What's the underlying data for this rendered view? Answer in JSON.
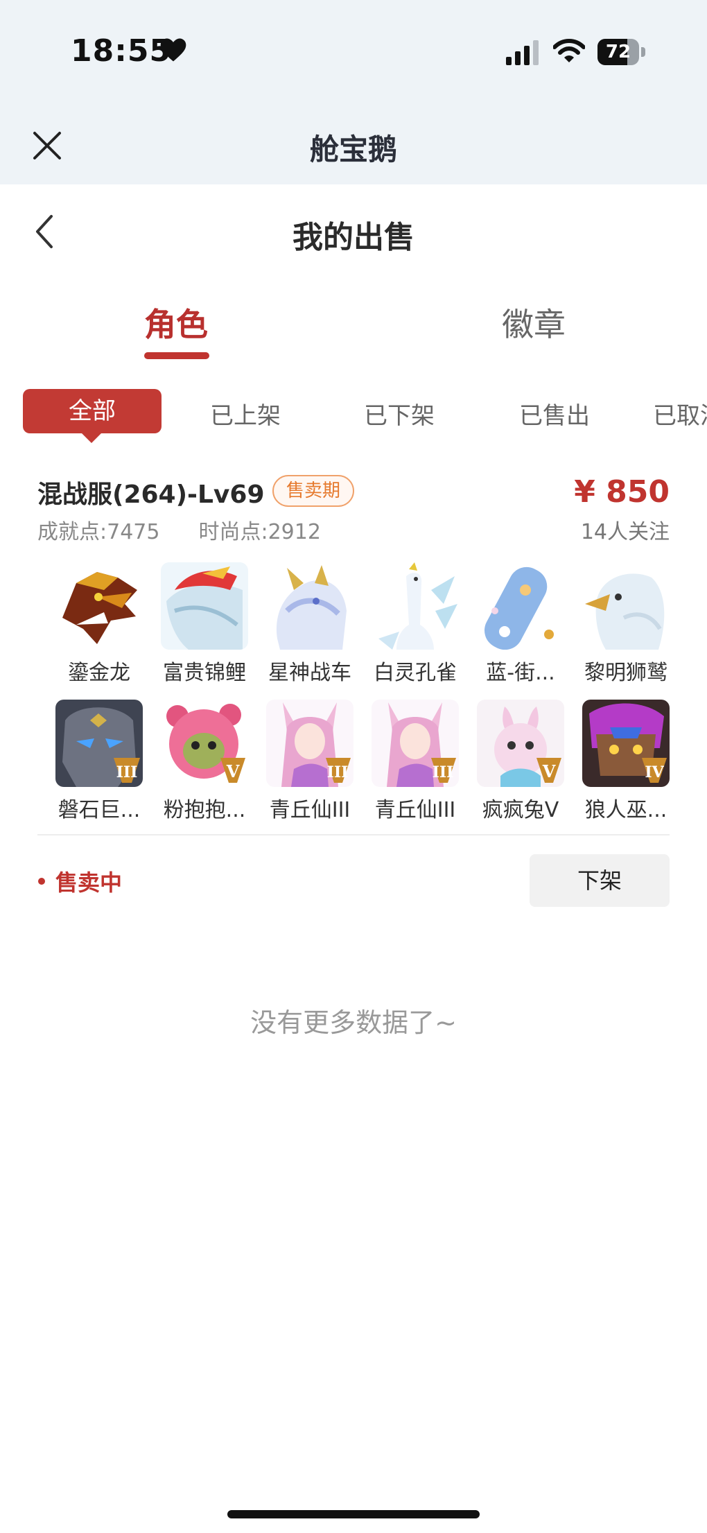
{
  "status_bar": {
    "time": "18:55",
    "battery": "72",
    "battery_level": 0.72
  },
  "app_bar": {
    "title": "舱宝鹅"
  },
  "header": {
    "title": "我的出售"
  },
  "tabs": [
    {
      "label": "角色",
      "active": true
    },
    {
      "label": "徽章",
      "active": false
    }
  ],
  "filters": [
    {
      "label": "全部",
      "active": true
    },
    {
      "label": "已上架"
    },
    {
      "label": "已下架"
    },
    {
      "label": "已售出"
    },
    {
      "label": "已取消"
    }
  ],
  "listing": {
    "title": "混战服(264)-Lv69",
    "period_badge": "售卖期",
    "price": "¥ 850",
    "achievement_label": "成就点:",
    "achievement_value": "7475",
    "fashion_label": "时尚点:",
    "fashion_value": "2912",
    "followers": "14人关注",
    "items": [
      {
        "name": "鎏金龙",
        "icon": "golden-dragon-icon"
      },
      {
        "name": "富贵锦鲤",
        "icon": "koi-fish-icon"
      },
      {
        "name": "星神战车",
        "icon": "star-chariot-icon"
      },
      {
        "name": "白灵孔雀",
        "icon": "white-peacock-icon"
      },
      {
        "name": "蓝-街...",
        "icon": "blue-skateboard-icon"
      },
      {
        "name": "黎明狮鹫",
        "icon": "griffin-icon"
      },
      {
        "name": "磐石巨...",
        "icon": "stone-giant-icon",
        "tier": "III"
      },
      {
        "name": "粉抱抱...",
        "icon": "pink-bear-icon",
        "tier": "V"
      },
      {
        "name": "青丘仙III",
        "icon": "fox-fairy-icon",
        "tier": "III"
      },
      {
        "name": "青丘仙III",
        "icon": "fox-fairy-icon",
        "tier": "III"
      },
      {
        "name": "疯疯兔V",
        "icon": "crazy-rabbit-icon",
        "tier": "V"
      },
      {
        "name": "狼人巫...",
        "icon": "werewolf-icon",
        "tier": "IV"
      }
    ],
    "status": "售卖中",
    "delist_button": "下架"
  },
  "footer": {
    "no_more": "没有更多数据了~"
  },
  "colors": {
    "accent": "#c0342f",
    "badge": "#e67a2e",
    "header_bg": "#eef3f7"
  }
}
